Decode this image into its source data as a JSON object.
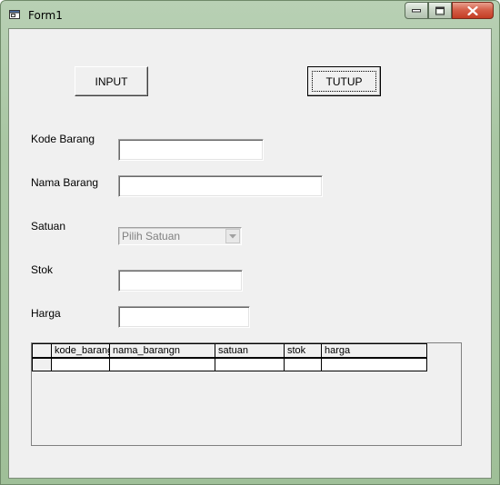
{
  "window": {
    "title": "Form1",
    "icon": "form-icon"
  },
  "buttons": {
    "input_label": "INPUT",
    "tutup_label": "TUTUP"
  },
  "labels": {
    "kode_barang": "Kode Barang",
    "nama_barang": "Nama Barang",
    "satuan": "Satuan",
    "stok": "Stok",
    "harga": "Harga"
  },
  "fields": {
    "kode_barang": "",
    "nama_barang": "",
    "stok": "",
    "harga": ""
  },
  "satuan_combo": {
    "selected": "Pilih Satuan"
  },
  "grid": {
    "columns": [
      "kode_barang",
      "nama_barangn",
      "satuan",
      "stok",
      "harga"
    ],
    "rows": [
      [
        "",
        "",
        "",
        "",
        ""
      ]
    ]
  },
  "colors": {
    "accent": "#a9c6a3",
    "form_bg": "#f0f0f0",
    "close_button": "#c33c23"
  }
}
